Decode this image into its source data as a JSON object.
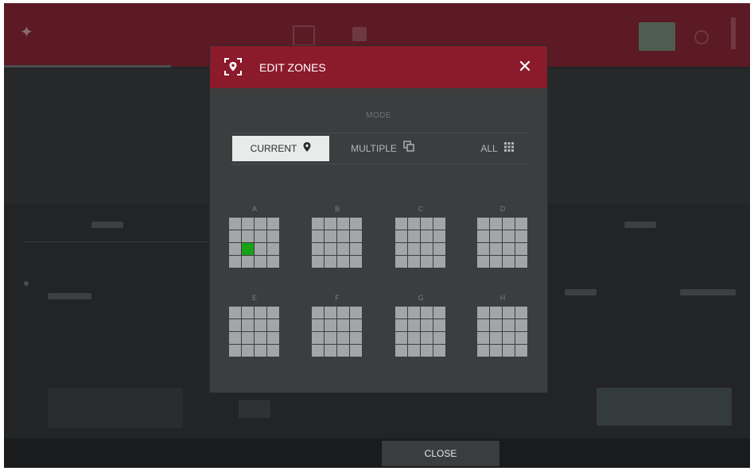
{
  "dialog": {
    "title": "EDIT ZONES",
    "icon": "zone-pin-icon",
    "close_icon": "close-icon"
  },
  "mode": {
    "label": "MODE",
    "options": [
      {
        "label": "CURRENT",
        "icon": "location-pin-icon",
        "selected": true
      },
      {
        "label": "MULTIPLE",
        "icon": "copy-icon",
        "selected": false
      },
      {
        "label": "ALL",
        "icon": "grid-icon",
        "selected": false
      }
    ]
  },
  "zones": [
    {
      "label": "A",
      "active_pad": [
        2,
        1
      ]
    },
    {
      "label": "B"
    },
    {
      "label": "C"
    },
    {
      "label": "D"
    },
    {
      "label": "E"
    },
    {
      "label": "F"
    },
    {
      "label": "G"
    },
    {
      "label": "H"
    }
  ],
  "colors": {
    "header": "#8b1a2b",
    "active_pad": "#17a217",
    "pad": "#a3a5a7"
  },
  "footer": {
    "close_label": "CLOSE"
  }
}
